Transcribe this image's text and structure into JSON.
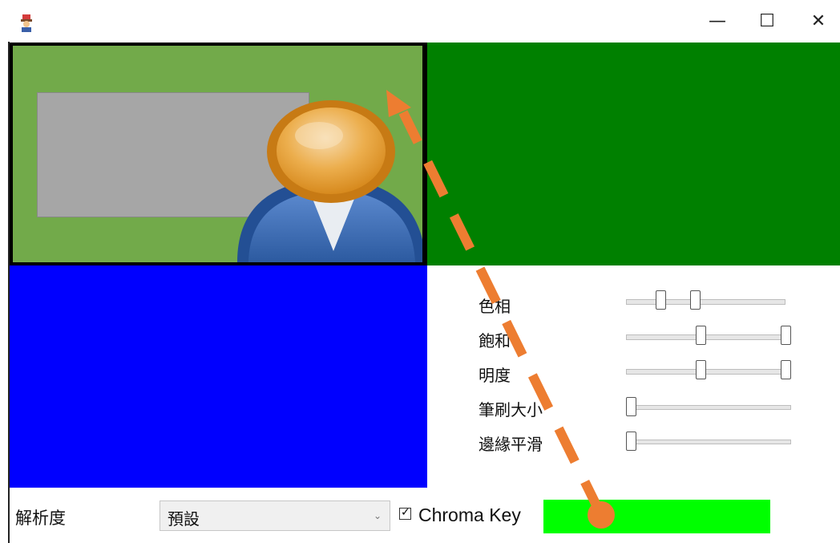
{
  "window": {
    "minimize_glyph": "—",
    "maximize_glyph": "☐",
    "close_glyph": "✕"
  },
  "sliders": [
    {
      "label": "色相",
      "thumbs": [
        0.2,
        0.43
      ]
    },
    {
      "label": "飽和",
      "thumbs": [
        0.45,
        1.0
      ]
    },
    {
      "label": "明度",
      "thumbs": [
        0.45,
        1.0
      ]
    },
    {
      "label": "筆刷大小",
      "thumbs": [
        0.0
      ]
    },
    {
      "label": "邊緣平滑",
      "thumbs": [
        0.0
      ]
    }
  ],
  "resolution": {
    "label": "解析度",
    "selected": "預設"
  },
  "chroma_key": {
    "label": "Chroma Key",
    "checked": true,
    "color": "#00ff00"
  },
  "colors": {
    "cam_background": "#72aa4a",
    "green_panel": "#008000",
    "blue_panel": "#0000ff",
    "arrow": "#ed7d31"
  },
  "icons": {
    "app": "app-icon",
    "person": "user-avatar-icon"
  }
}
